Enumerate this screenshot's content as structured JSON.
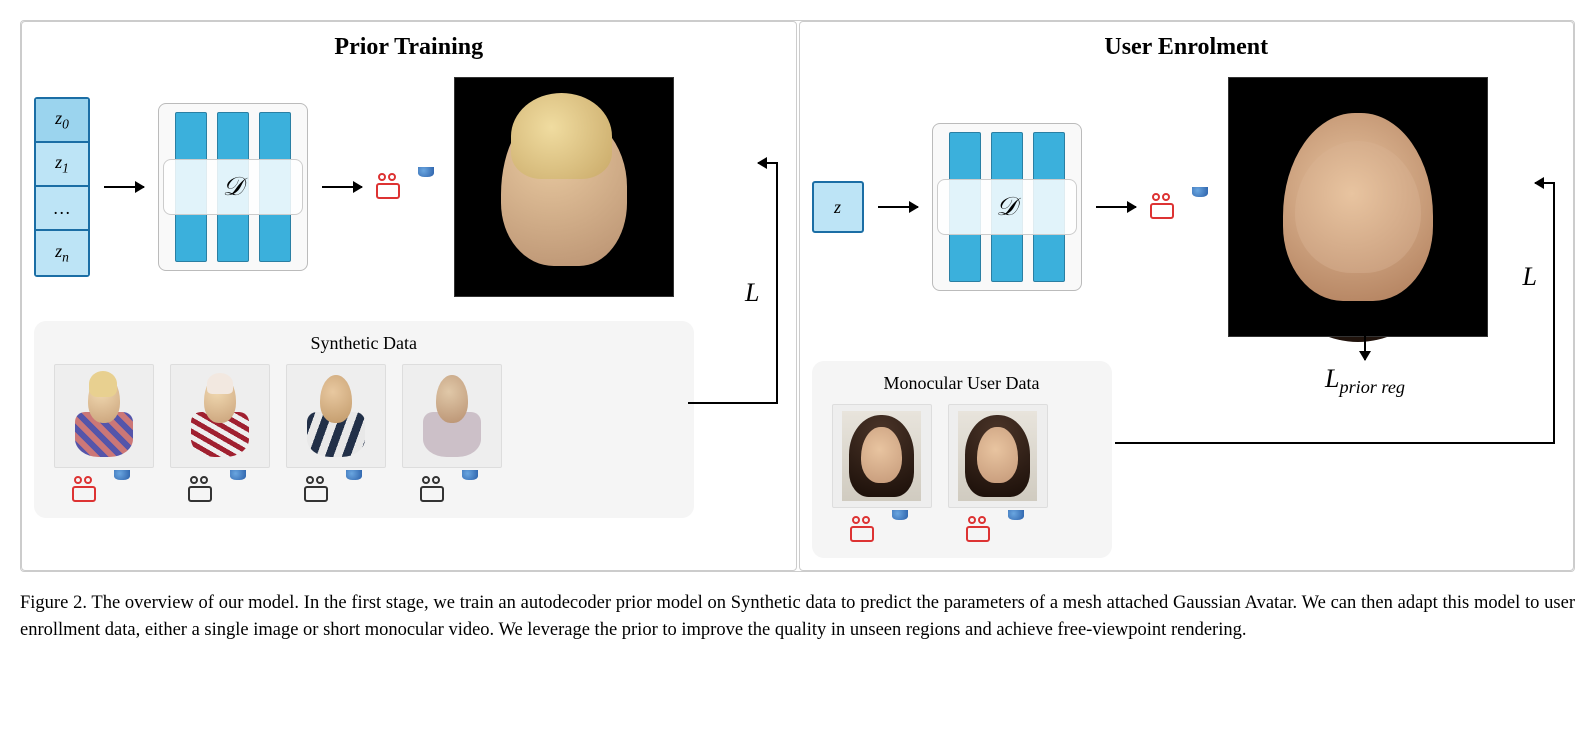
{
  "panels": {
    "left_title": "Prior Training",
    "right_title": "User Enrolment"
  },
  "latent": {
    "z0": "z",
    "z0_sub": "0",
    "z1": "z",
    "z1_sub": "1",
    "dots": "…",
    "zn": "z",
    "zn_sub": "n",
    "single": "z"
  },
  "decoder": {
    "label": "𝒟"
  },
  "data_panels": {
    "synthetic_title": "Synthetic Data",
    "user_title": "Monocular User Data"
  },
  "loss": {
    "L_left": "L",
    "L_right": "L",
    "L_prior_reg_main": "L",
    "L_prior_reg_sub": "prior reg"
  },
  "caption": {
    "fig": "Figure 2.",
    "text": " The overview of our model. In the first stage, we train an autodecoder prior model on Synthetic data to predict the parameters of a mesh attached Gaussian Avatar. We can then adapt this model to user enrollment data, either a single image or short monocular video. We leverage the prior to improve the quality in unseen regions and achieve free-viewpoint rendering."
  },
  "chart_data": {
    "type": "diagram",
    "title": "Model Overview: Prior Training and User Enrolment pipeline",
    "stages": [
      {
        "name": "Prior Training",
        "input": "latent codes z_0 ... z_n",
        "module": "autodecoder D",
        "auxiliary": [
          "camera pose",
          "head mesh"
        ],
        "output": "rendered Gaussian avatar (profile head)",
        "training_data": "Synthetic Data (multi-subject, camera + mesh per sample)",
        "losses": [
          "L (reconstruction vs synthetic renders)"
        ]
      },
      {
        "name": "User Enrolment",
        "input": "single latent code z",
        "module": "autodecoder D (shared / adapted)",
        "auxiliary": [
          "camera pose",
          "head mesh"
        ],
        "output": "rendered Gaussian avatar (frontal face)",
        "training_data": "Monocular User Data (single image or short video)",
        "losses": [
          "L (reconstruction vs user frames)",
          "L_prior_reg (regularization toward prior)"
        ]
      }
    ]
  }
}
